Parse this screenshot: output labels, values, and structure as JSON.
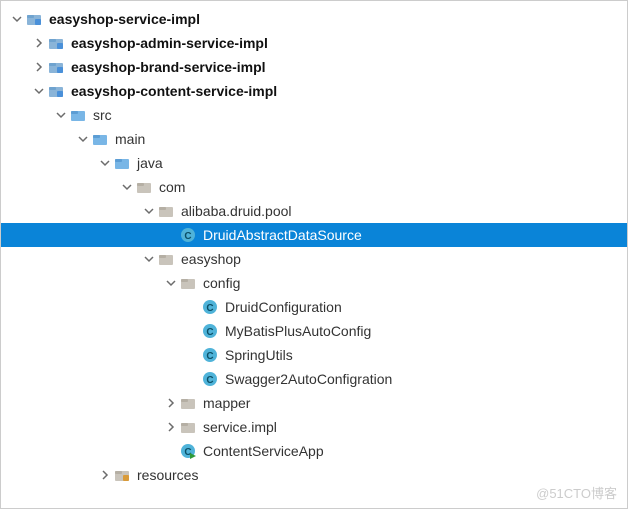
{
  "watermark": "@51CTO博客",
  "icons": {
    "module_root": "module-folder-icon",
    "module": "module-folder-icon",
    "src_folder": "source-folder-icon",
    "package_folder": "package-folder-icon",
    "package": "package-folder-icon",
    "java_class": "java-class-icon",
    "java_main": "java-main-class-icon",
    "resources_folder": "resources-folder-icon"
  },
  "tree": [
    {
      "id": 0,
      "depth": 0,
      "arrow": "down",
      "icon": "module_root",
      "bold": true,
      "selected": false,
      "label": "easyshop-service-impl"
    },
    {
      "id": 1,
      "depth": 1,
      "arrow": "right",
      "icon": "module",
      "bold": true,
      "selected": false,
      "label": "easyshop-admin-service-impl"
    },
    {
      "id": 2,
      "depth": 1,
      "arrow": "right",
      "icon": "module",
      "bold": true,
      "selected": false,
      "label": "easyshop-brand-service-impl"
    },
    {
      "id": 3,
      "depth": 1,
      "arrow": "down",
      "icon": "module",
      "bold": true,
      "selected": false,
      "label": "easyshop-content-service-impl"
    },
    {
      "id": 4,
      "depth": 2,
      "arrow": "down",
      "icon": "src_folder",
      "bold": false,
      "selected": false,
      "label": "src"
    },
    {
      "id": 5,
      "depth": 3,
      "arrow": "down",
      "icon": "src_folder",
      "bold": false,
      "selected": false,
      "label": "main"
    },
    {
      "id": 6,
      "depth": 4,
      "arrow": "down",
      "icon": "src_folder",
      "bold": false,
      "selected": false,
      "label": "java"
    },
    {
      "id": 7,
      "depth": 5,
      "arrow": "down",
      "icon": "package_folder",
      "bold": false,
      "selected": false,
      "label": "com"
    },
    {
      "id": 8,
      "depth": 6,
      "arrow": "down",
      "icon": "package",
      "bold": false,
      "selected": false,
      "label": "alibaba.druid.pool"
    },
    {
      "id": 9,
      "depth": 7,
      "arrow": "none",
      "icon": "java_class",
      "bold": false,
      "selected": true,
      "label": "DruidAbstractDataSource"
    },
    {
      "id": 10,
      "depth": 6,
      "arrow": "down",
      "icon": "package",
      "bold": false,
      "selected": false,
      "label": "easyshop"
    },
    {
      "id": 11,
      "depth": 7,
      "arrow": "down",
      "icon": "package",
      "bold": false,
      "selected": false,
      "label": "config"
    },
    {
      "id": 12,
      "depth": 8,
      "arrow": "none",
      "icon": "java_class",
      "bold": false,
      "selected": false,
      "label": "DruidConfiguration"
    },
    {
      "id": 13,
      "depth": 8,
      "arrow": "none",
      "icon": "java_class",
      "bold": false,
      "selected": false,
      "label": "MyBatisPlusAutoConfig"
    },
    {
      "id": 14,
      "depth": 8,
      "arrow": "none",
      "icon": "java_class",
      "bold": false,
      "selected": false,
      "label": "SpringUtils"
    },
    {
      "id": 15,
      "depth": 8,
      "arrow": "none",
      "icon": "java_class",
      "bold": false,
      "selected": false,
      "label": "Swagger2AutoConfigration"
    },
    {
      "id": 16,
      "depth": 7,
      "arrow": "right",
      "icon": "package",
      "bold": false,
      "selected": false,
      "label": "mapper"
    },
    {
      "id": 17,
      "depth": 7,
      "arrow": "right",
      "icon": "package",
      "bold": false,
      "selected": false,
      "label": "service.impl"
    },
    {
      "id": 18,
      "depth": 7,
      "arrow": "none",
      "icon": "java_main",
      "bold": false,
      "selected": false,
      "label": "ContentServiceApp"
    },
    {
      "id": 19,
      "depth": 4,
      "arrow": "right",
      "icon": "resources_folder",
      "bold": false,
      "selected": false,
      "label": "resources"
    }
  ]
}
